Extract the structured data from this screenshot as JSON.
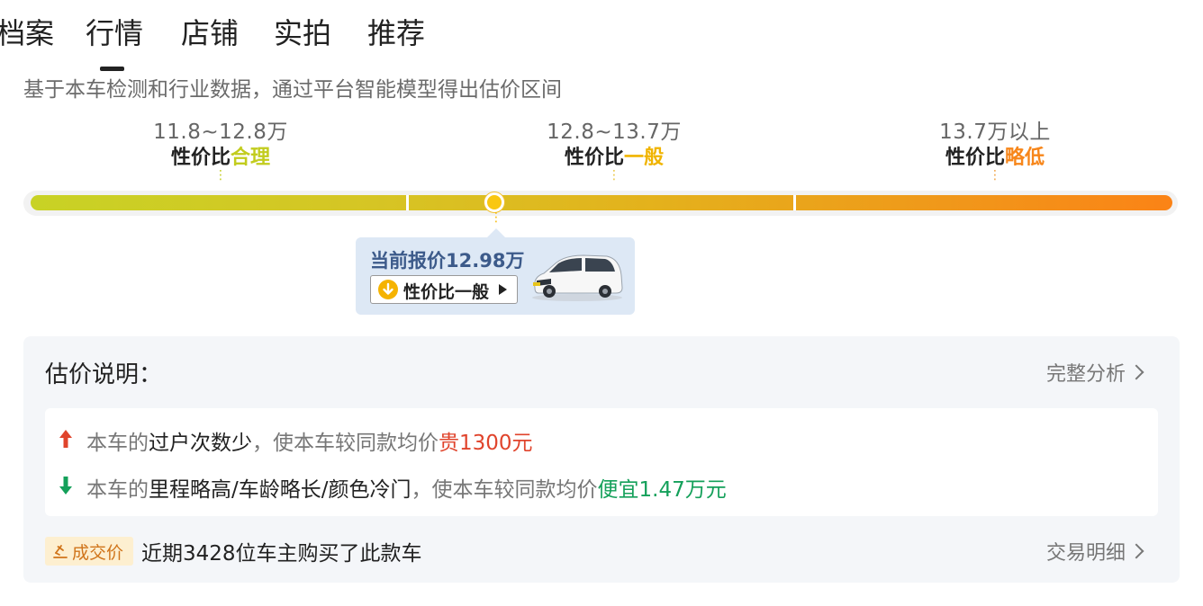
{
  "tabs": [
    "档案",
    "行情",
    "店铺",
    "实拍",
    "推荐"
  ],
  "active_tab": "行情",
  "subtitle": "基于本车检测和行业数据，通过平台智能模型得出估价区间",
  "ranges": [
    {
      "price": "11.8~12.8万",
      "prefix": "性价比",
      "grade": "合理",
      "color": "#c2cc1e"
    },
    {
      "price": "12.8~13.7万",
      "prefix": "性价比",
      "grade": "一般",
      "color": "#f0b400"
    },
    {
      "price": "13.7万以上",
      "prefix": "性价比",
      "grade": "略低",
      "color": "#f7861a"
    }
  ],
  "current": {
    "title": "当前报价12.98万",
    "badge": "性价比一般",
    "price_value_wan": 12.98
  },
  "explain": {
    "title": "估价说明：",
    "full_analysis": "完整分析",
    "reasons": [
      {
        "pre": "本车的",
        "factor": "过户次数少",
        "mid": "，使本车较同款均价",
        "result": "贵1300元",
        "direction": "up",
        "color": "#e0442c"
      },
      {
        "pre": "本车的",
        "factor": "里程略高/车龄略长/颜色冷门",
        "mid": "，使本车较同款均价",
        "result": "便宜1.47万元",
        "direction": "down",
        "color": "#14a05a"
      }
    ],
    "deal_badge": "成交价",
    "deal_text": "近期3428位车主购买了此款车",
    "deal_link": "交易明细"
  }
}
